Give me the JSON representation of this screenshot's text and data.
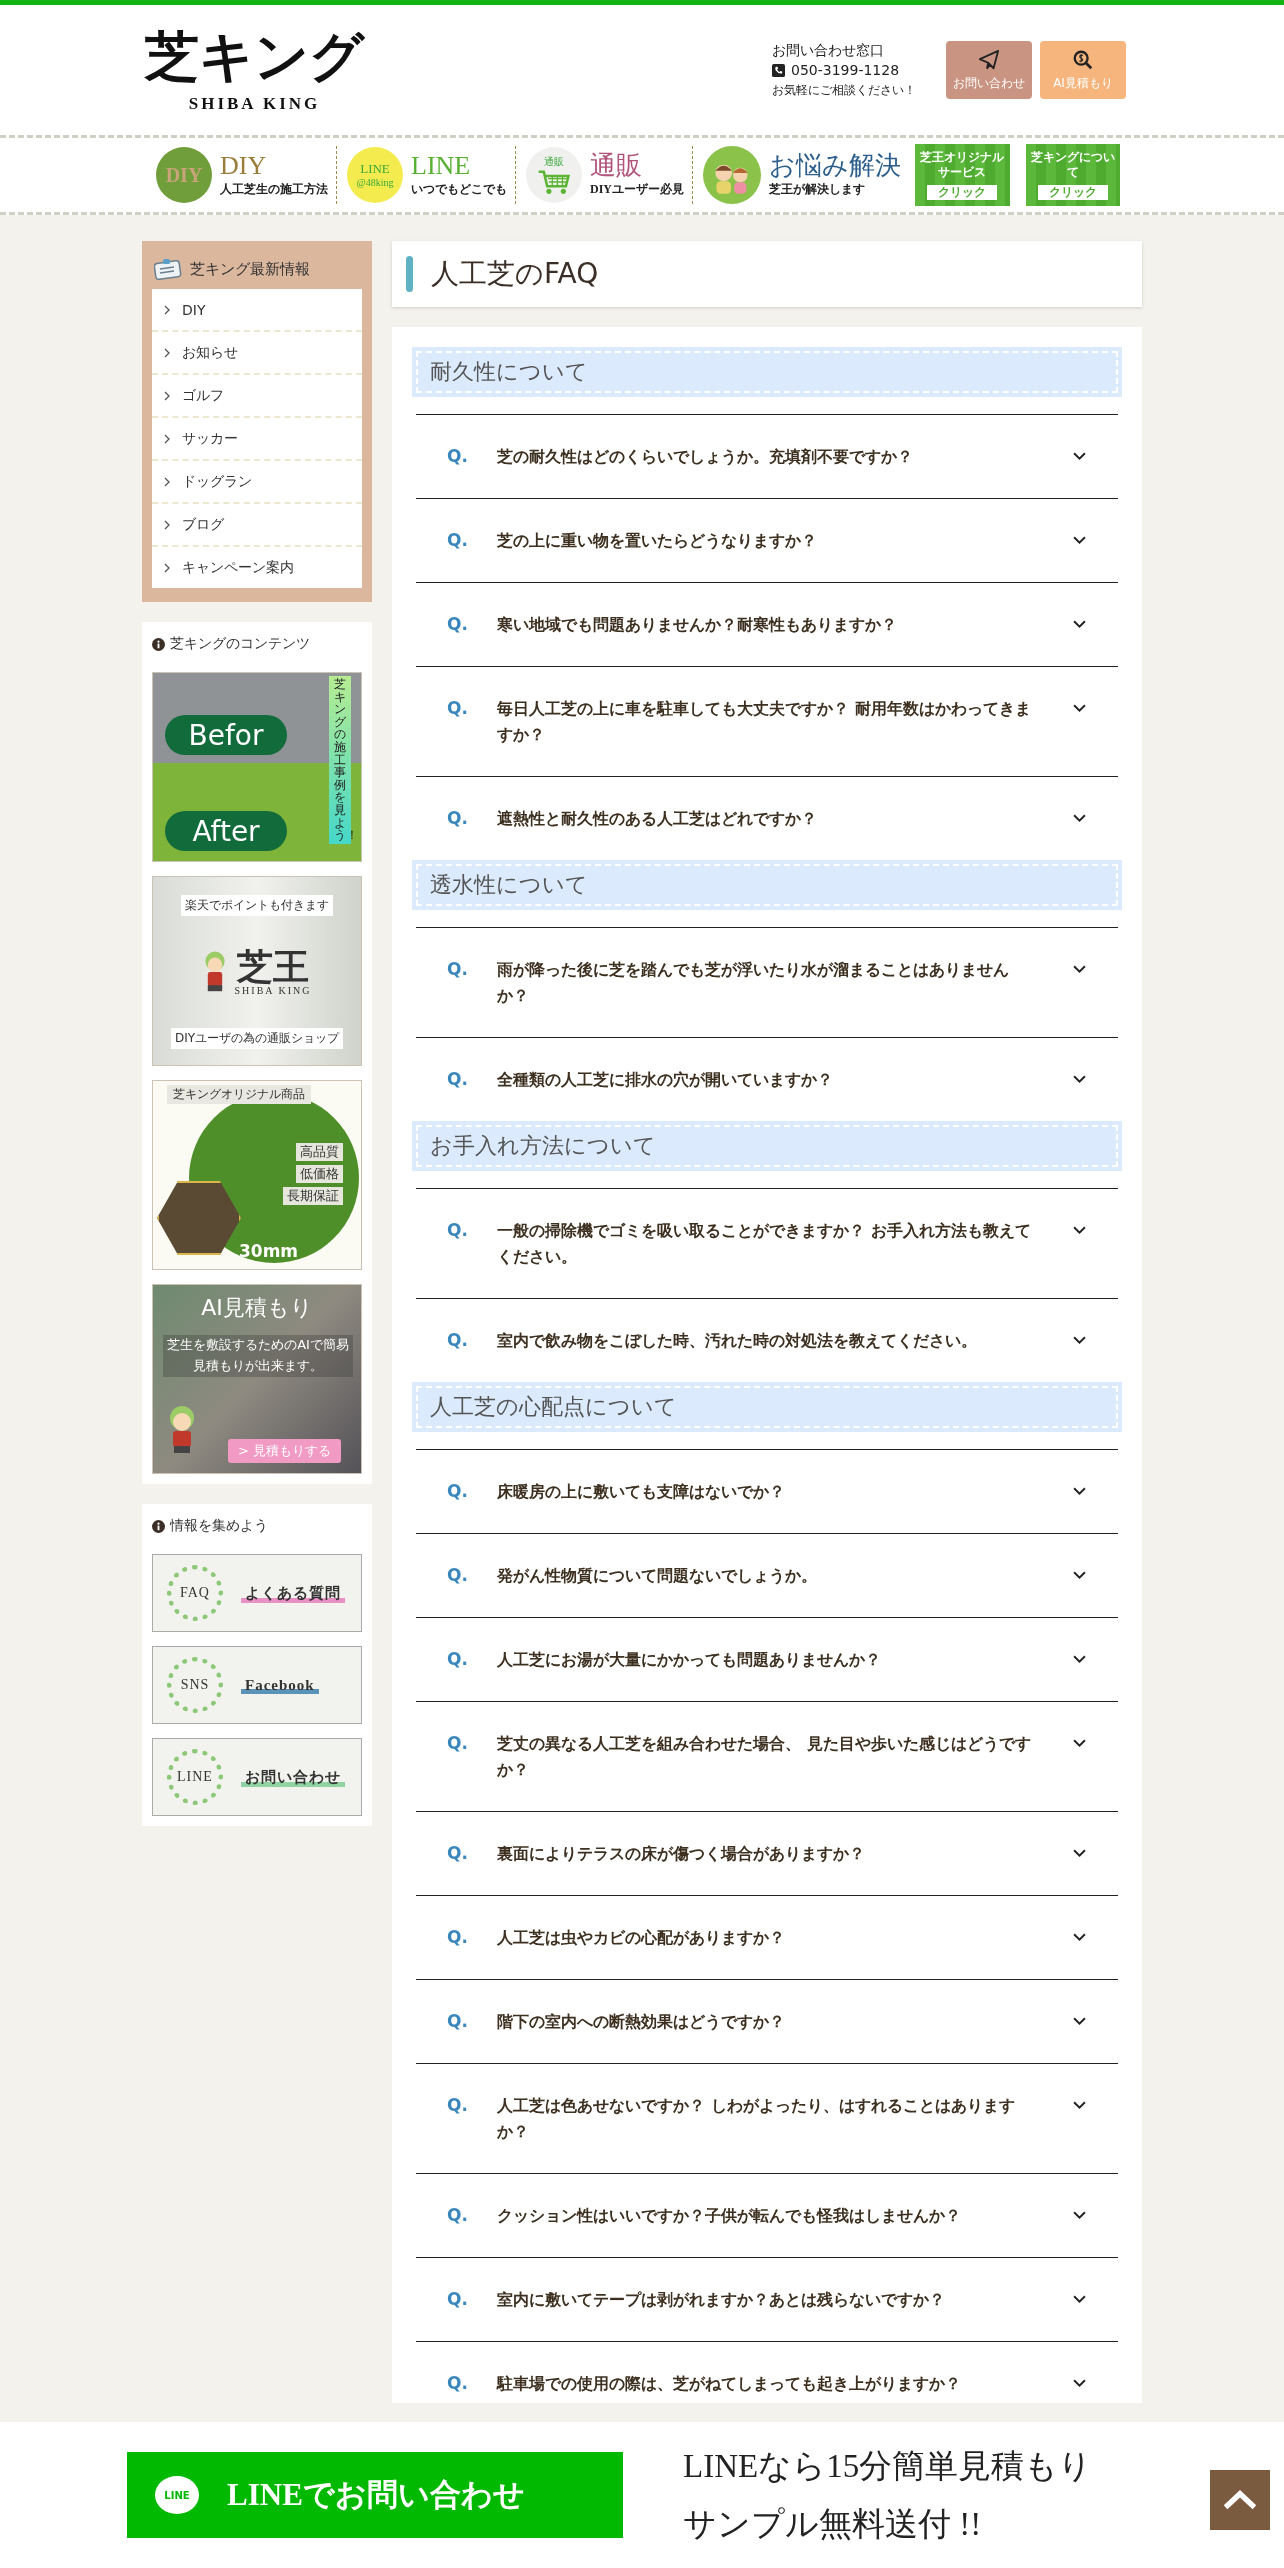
{
  "header": {
    "logo": {
      "title": "芝キング",
      "subtitle": "SHIBA KING"
    },
    "contact": {
      "label": "お問い合わせ窓口",
      "phone": "050-3199-1128",
      "note": "お気軽にご相談ください！"
    },
    "buttons": [
      {
        "kind": "contact",
        "label": "お問い合わせ"
      },
      {
        "kind": "estimate",
        "label": "AI見積もり"
      }
    ]
  },
  "nav": [
    {
      "kind": "diy",
      "badge": "DIY",
      "title": "DIY",
      "subtitle": "人工芝生の施工方法"
    },
    {
      "kind": "line",
      "badge": "LINE",
      "badge_sub": "@48king",
      "title": "LINE",
      "subtitle": "いつでもどこでも"
    },
    {
      "kind": "shop",
      "badge": "通販",
      "title": "通販",
      "subtitle": "DIYユーザー必見"
    },
    {
      "kind": "help",
      "title": "お悩み解決",
      "subtitle": "芝王が解決します"
    },
    {
      "kind": "tile",
      "title": "芝王オリジナルサービス",
      "action": "クリック"
    },
    {
      "kind": "tile",
      "title": "芝キングについて",
      "action": "クリック"
    }
  ],
  "sidebar": {
    "news": {
      "title": "芝キング最新情報",
      "items": [
        "DIY",
        "お知らせ",
        "ゴルフ",
        "サッカー",
        "ドッグラン",
        "ブログ",
        "キャンペーン案内"
      ]
    },
    "contents": {
      "title": "芝キングのコンテンツ",
      "banners": [
        {
          "kind": "cases",
          "labels": [
            "Befor",
            "After"
          ],
          "caption": "芝キングの施工事例を見よう！"
        },
        {
          "kind": "shop",
          "labels": [
            "楽天でポイントも付きます",
            "DIYユーザの為の通販ショップ"
          ],
          "logo": "芝王",
          "logo_sub": "SHIBA KING"
        },
        {
          "kind": "product",
          "labels": [
            "芝キングオリジナル商品",
            "高品質",
            "低価格",
            "長期保証",
            "30mm"
          ]
        },
        {
          "kind": "ai",
          "labels": [
            "AI見積もり",
            "芝生を敷設するためのAIで簡易見積もりが出来ます。",
            "> 見積もりする"
          ]
        }
      ]
    },
    "info": {
      "title": "情報を集めよう",
      "links": [
        {
          "emblem": "FAQ",
          "label": "よくある質問",
          "color": "#e891c4"
        },
        {
          "emblem": "SNS",
          "label": "Facebook",
          "color": "#5b93b8"
        },
        {
          "emblem": "LINE",
          "label": "お問い合わせ",
          "color": "#8fd3a2"
        }
      ]
    }
  },
  "main": {
    "title": "人工芝のFAQ",
    "sections": [
      {
        "heading": "耐久性について",
        "questions": [
          {
            "marker": "Q.",
            "text": "芝の耐久性はどのくらいでしょうか。充填剤不要ですか？",
            "expanded": false
          },
          {
            "marker": "Q.",
            "text": "芝の上に重い物を置いたらどうなりますか？",
            "expanded": false
          },
          {
            "marker": "Q.",
            "text": "寒い地域でも問題ありませんか？耐寒性もありますか？",
            "expanded": false
          },
          {
            "marker": "Q.",
            "text": "毎日人工芝の上に車を駐車しても大丈夫ですか？ 耐用年数はかわってきますか？",
            "expanded": false
          },
          {
            "marker": "Q.",
            "text": "遮熱性と耐久性のある人工芝はどれですか？",
            "expanded": false
          }
        ]
      },
      {
        "heading": "透水性について",
        "questions": [
          {
            "marker": "Q.",
            "text": "雨が降った後に芝を踏んでも芝が浮いたり水が溜まることはありませんか？",
            "expanded": false
          },
          {
            "marker": "Q.",
            "text": "全種類の人工芝に排水の穴が開いていますか？",
            "expanded": false
          }
        ]
      },
      {
        "heading": "お手入れ方法について",
        "questions": [
          {
            "marker": "Q.",
            "text": "一般の掃除機でゴミを吸い取ることができますか？ お手入れ方法も教えてください。",
            "expanded": false
          },
          {
            "marker": "Q.",
            "text": "室内で飲み物をこぼした時、汚れた時の対処法を教えてください。",
            "expanded": false
          }
        ]
      },
      {
        "heading": "人工芝の心配点について",
        "questions": [
          {
            "marker": "Q.",
            "text": "床暖房の上に敷いても支障はないでか？",
            "expanded": false
          },
          {
            "marker": "Q.",
            "text": "発がん性物質について問題ないでしょうか。",
            "expanded": false
          },
          {
            "marker": "Q.",
            "text": "人工芝にお湯が大量にかかっても問題ありませんか？",
            "expanded": false
          },
          {
            "marker": "Q.",
            "text": "芝丈の異なる人工芝を組み合わせた場合、 見た目や歩いた感じはどうですか？",
            "expanded": false
          },
          {
            "marker": "Q.",
            "text": "裏面によりテラスの床が傷つく場合がありますか？",
            "expanded": false
          },
          {
            "marker": "Q.",
            "text": "人工芝は虫やカビの心配がありますか？",
            "expanded": false
          },
          {
            "marker": "Q.",
            "text": "階下の室内への断熱効果はどうですか？",
            "expanded": false
          },
          {
            "marker": "Q.",
            "text": "人工芝は色あせないですか？ しわがよったり、はすれることはありますか？",
            "expanded": false
          },
          {
            "marker": "Q.",
            "text": "クッション性はいいですか？子供が転んでも怪我はしませんか？",
            "expanded": false
          },
          {
            "marker": "Q.",
            "text": "室内に敷いてテープは剥がれますか？あとは残らないですか？",
            "expanded": false
          },
          {
            "marker": "Q.",
            "text": "駐車場での使用の際は、芝がねてしまっても起き上がりますか？",
            "expanded": false
          }
        ]
      }
    ]
  },
  "footer": {
    "line_button": {
      "icon": "LINE",
      "label": "LINEでお問い合わせ"
    },
    "lines": [
      "LINEなら15分簡単見積もり",
      "サンプル無料送付 !!"
    ]
  }
}
